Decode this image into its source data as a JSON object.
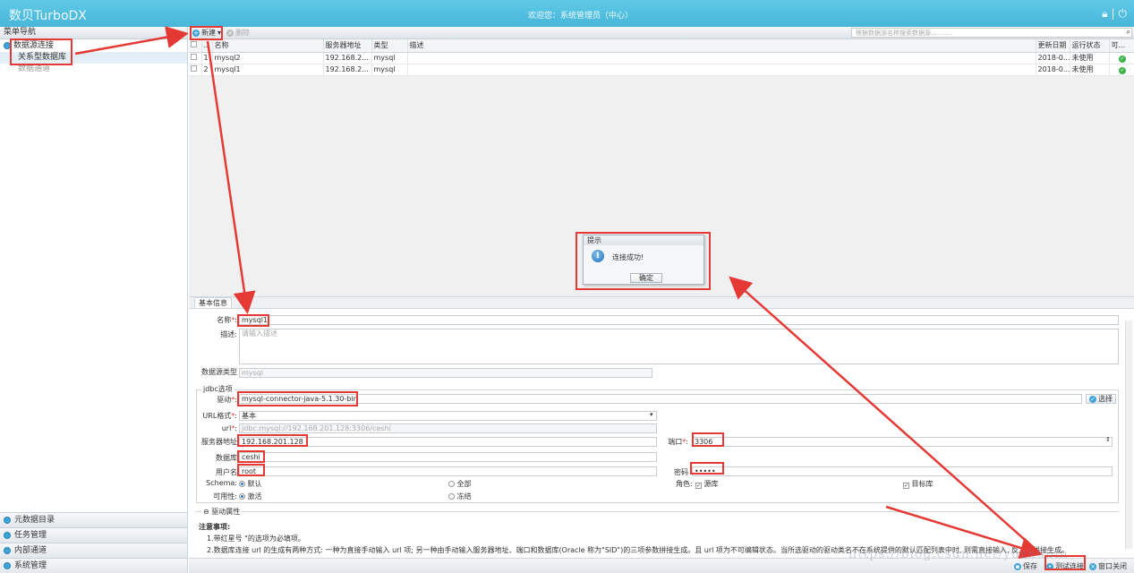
{
  "header": {
    "logo": "数贝TurboDX",
    "welcome": "欢迎您：系统管理员（中心）"
  },
  "sidebar": {
    "title": "菜单导航",
    "group1": "数据源连接",
    "items": [
      "关系型数据库",
      "数据通道"
    ],
    "bottom": [
      "元数据目录",
      "任务管理",
      "内部通道",
      "系统管理"
    ]
  },
  "toolbar": {
    "new_label": "新建",
    "delete_label": "删除",
    "search_placeholder": "根据数据源名称搜索数据源..........."
  },
  "table": {
    "headers": [
      "",
      "",
      "名称",
      "服务器地址",
      "类型",
      "描述",
      "更新日期",
      "运行状态",
      "可..."
    ],
    "rows": [
      {
        "index": "1",
        "name": "mysql2",
        "server": "192.168.2...",
        "type": "mysql",
        "desc": "",
        "date": "2018-0...",
        "status": "未使用"
      },
      {
        "index": "2",
        "name": "mysql1",
        "server": "192.168.2...",
        "type": "mysql",
        "desc": "",
        "date": "2018-0...",
        "status": "未使用"
      }
    ]
  },
  "form": {
    "tab": "基本信息",
    "name_label": "名称",
    "name_value": "mysql1",
    "desc_label": "描述:",
    "desc_placeholder": "请输入描述",
    "dstype_label": "数据源类型",
    "dstype_value": "mysql",
    "jdbc_legend": "jdbc选项",
    "driver_label": "驱动",
    "driver_value": "mysql-connector-java-5.1.30-bin",
    "select_btn": "选择",
    "urlfmt_label": "URL格式",
    "urlfmt_value": "基本",
    "url_label": "url",
    "url_value": "jdbc:mysql://192.168.201.128:3306/ceshi",
    "server_label": "服务器地址",
    "server_value": "192.168.201.128",
    "port_label": "端口",
    "port_value": "3306",
    "db_label": "数据库",
    "db_value": "ceshi",
    "user_label": "用户名",
    "user_value": "root",
    "pwd_label": "密码",
    "pwd_value": "•••••",
    "schema_label": "Schema:",
    "schema_opt1": "默认",
    "schema_opt2": "全部",
    "role_label": "角色:",
    "role_opt1": "源库",
    "role_opt2": "目标库",
    "avail_label": "可用性:",
    "avail_opt1": "激活",
    "avail_opt2": "冻结",
    "driver_props": "驱动属性",
    "notes_title": "注意事项:",
    "note1": "1.带红星号 \"的选项为必填项。",
    "note2": "2.数据库连接 url 的生成有两种方式: 一种为直接手动输入 url 项; 另一种由手动输入服务器地址、端口和数据库(Oracle 称为\"SID\")的三项参数拼接生成。且 url 项为不可编辑状态。当所选驱动的驱动类名不在系统提供的默认匹配列表中时, 则需直接输入, 反之则拼接生成。"
  },
  "buttons": {
    "save": "保存",
    "test": "测试连接",
    "close": "窗口关闭"
  },
  "modal": {
    "title": "提示",
    "message": "连接成功!",
    "ok": "确定"
  },
  "watermark": "https://blog.csdn.net/yuzhubin"
}
